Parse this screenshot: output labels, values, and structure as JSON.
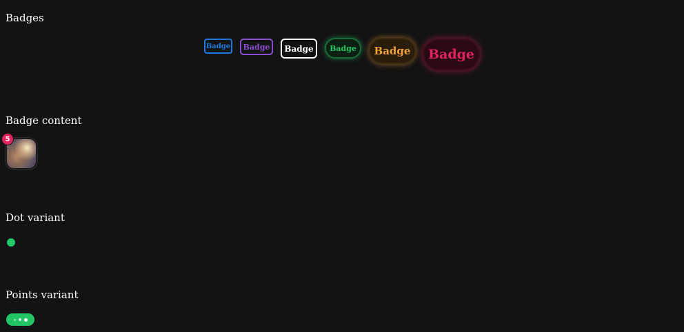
{
  "sections": {
    "badges_title": "Badges",
    "content_title": "Badge content",
    "dot_title": "Dot variant",
    "points_title": "Points variant"
  },
  "badges": [
    {
      "label": "Badge",
      "color": "#1f7ae0",
      "variant": "outline"
    },
    {
      "label": "Badge",
      "color": "#8b4fd6",
      "variant": "outline"
    },
    {
      "label": "Badge",
      "color": "#ffffff",
      "variant": "outline"
    },
    {
      "label": "Badge",
      "color": "#22c566",
      "variant": "glow"
    },
    {
      "label": "Badge",
      "color": "#f0a23a",
      "variant": "glow"
    },
    {
      "label": "Badge",
      "color": "#e0245e",
      "variant": "glow"
    }
  ],
  "badge_content": {
    "count": "5",
    "count_color": "#e0245e"
  },
  "dot_variant": {
    "color": "#22c566"
  },
  "points_variant": {
    "color": "#22c566"
  }
}
